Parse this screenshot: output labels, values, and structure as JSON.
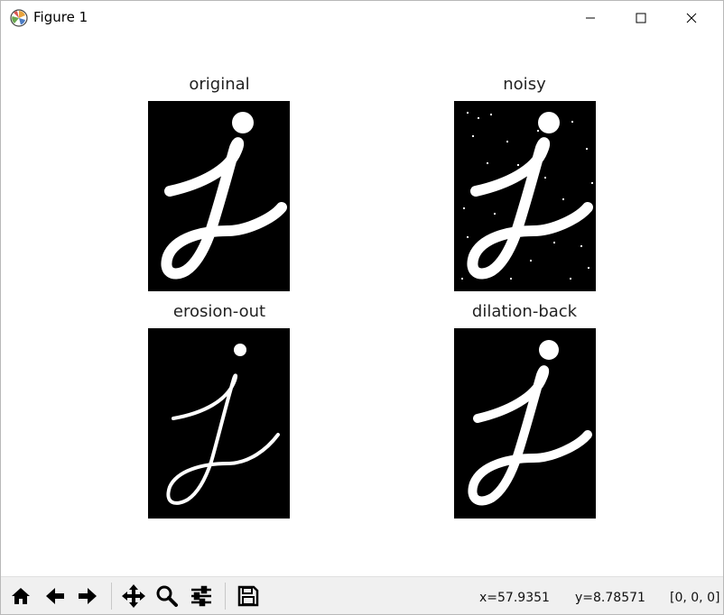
{
  "window": {
    "title": "Figure 1",
    "icons": {
      "app": "matplotlib-icon",
      "minimize": "minimize-icon",
      "maximize": "maximize-icon",
      "close": "close-icon"
    }
  },
  "subplots": [
    {
      "title": "original"
    },
    {
      "title": "noisy"
    },
    {
      "title": "erosion-out"
    },
    {
      "title": "dilation-back"
    }
  ],
  "toolbar": {
    "buttons": [
      "home-icon",
      "back-arrow-icon",
      "forward-arrow-icon",
      "pan-icon",
      "zoom-icon",
      "configure-subplots-icon",
      "save-icon"
    ]
  },
  "status": {
    "x": "x=57.9351",
    "y": "y=8.78571",
    "pixel": "[0, 0, 0]"
  }
}
